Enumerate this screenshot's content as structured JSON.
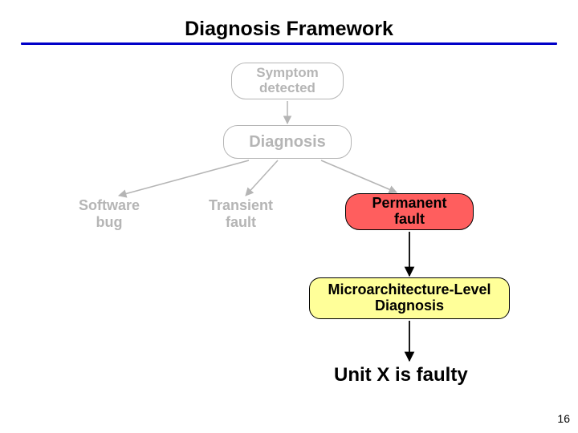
{
  "slide": {
    "title": "Diagnosis Framework",
    "page_number": "16"
  },
  "nodes": {
    "symptom": "Symptom\ndetected",
    "diagnosis": "Diagnosis",
    "software_bug": "Software\nbug",
    "transient_fault": "Transient\nfault",
    "permanent_fault": "Permanent\nfault",
    "microarch": "Microarchitecture-Level\nDiagnosis",
    "result": "Unit X is faulty"
  },
  "colors": {
    "rule": "#0000c8",
    "gray": "#b5b5b5",
    "perm_fill": "#ff5e5e",
    "micro_fill": "#ffff99"
  }
}
